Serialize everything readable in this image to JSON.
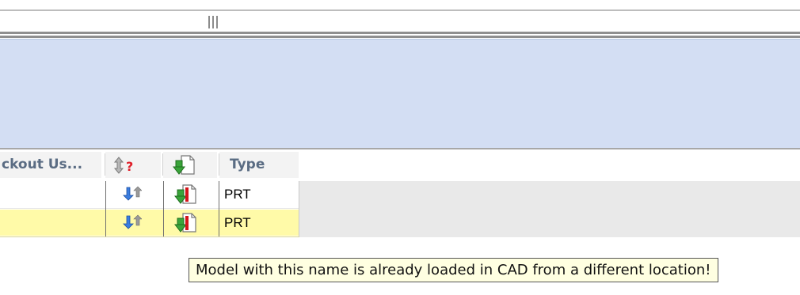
{
  "grid": {
    "columns": [
      {
        "label": "ckout Us...",
        "type": "text"
      },
      {
        "label": "",
        "type": "icon",
        "icon": "sort-updown-question-icon"
      },
      {
        "label": "",
        "type": "icon",
        "icon": "download-document-icon"
      },
      {
        "label": "Type",
        "type": "text"
      }
    ],
    "rows": [
      {
        "sync_icon": "sync-arrows-icon",
        "status_icon": "document-error-download-icon",
        "type": "PRT",
        "highlighted": false
      },
      {
        "sync_icon": "sync-arrows-icon",
        "status_icon": "document-error-download-icon",
        "type": "PRT",
        "highlighted": true
      }
    ]
  },
  "tooltip": {
    "text": "Model with this name is already loaded in CAD from a different location!"
  },
  "colors": {
    "panel_blue": "#d3def3",
    "row_highlight": "#fffaa8",
    "header_text": "#5a6c83",
    "tooltip_bg": "#ffffe1"
  }
}
